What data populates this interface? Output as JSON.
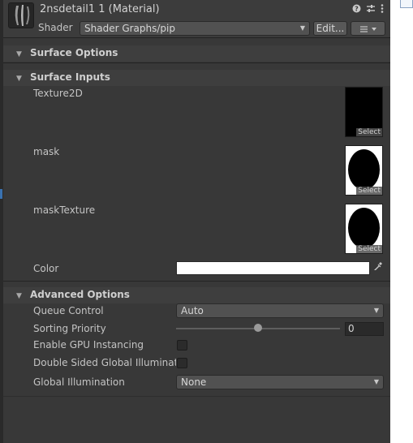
{
  "header": {
    "title": "2nsdetail1 1 (Material)",
    "shader_label": "Shader",
    "shader_value": "Shader Graphs/pip",
    "edit_label": "Edit...",
    "help_icon": "help-icon",
    "preset_icon": "preset-icon",
    "more_icon": "more-icon",
    "list_icon": "list-icon"
  },
  "sections": {
    "surface_options": "Surface Options",
    "surface_inputs": "Surface Inputs",
    "advanced_options": "Advanced Options"
  },
  "surface_inputs": {
    "texture2d_label": "Texture2D",
    "mask_label": "mask",
    "mask_texture_label": "maskTexture",
    "select_label": "Select",
    "color_label": "Color",
    "color_value": "#ffffff"
  },
  "advanced": {
    "queue_control_label": "Queue Control",
    "queue_control_value": "Auto",
    "sorting_priority_label": "Sorting Priority",
    "sorting_priority_value": "0",
    "sorting_priority_slider_fraction": 0.5,
    "gpu_instancing_label": "Enable GPU Instancing",
    "gpu_instancing_checked": false,
    "double_sided_gi_label": "Double Sided Global Illuminatio",
    "double_sided_gi_checked": false,
    "global_illumination_label": "Global Illumination",
    "global_illumination_value": "None"
  },
  "colors": {
    "background": "#383838",
    "accent": "#3a72b0"
  }
}
